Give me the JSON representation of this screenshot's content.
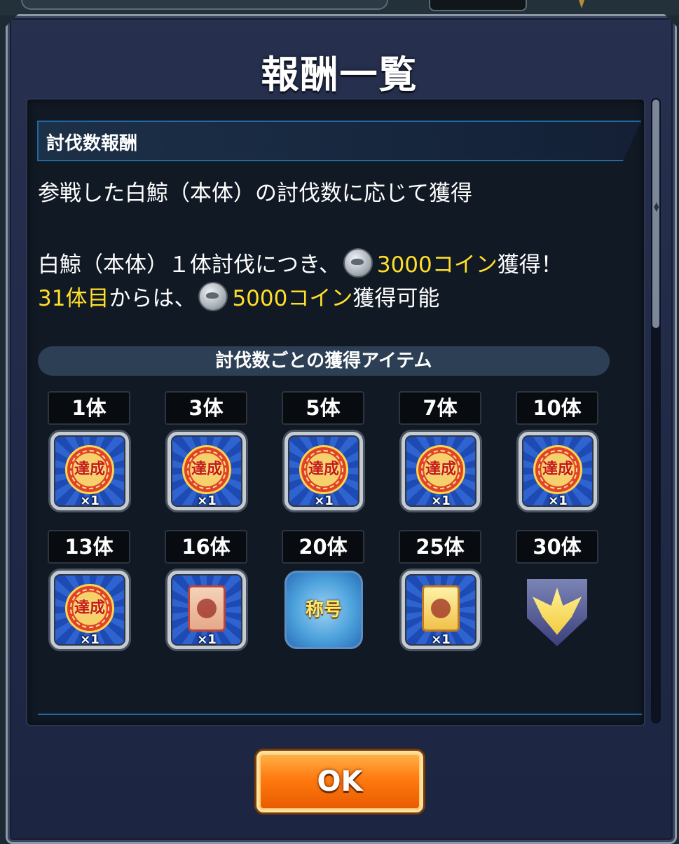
{
  "dialog": {
    "title": "報酬一覧",
    "section_header": "討伐数報酬",
    "description": "参戦した白鯨（本体）の討伐数に応じて獲得",
    "line1": {
      "pre": "白鯨（本体）１体討伐につき、",
      "amount": "3000コイン",
      "post": "獲得！"
    },
    "line2": {
      "highlight": "31体目",
      "pre": "からは、",
      "amount": "5000コイン",
      "post": "獲得可能"
    },
    "items_header": "討伐数ごとの獲得アイテム",
    "ok_label": "OK"
  },
  "rewards": [
    {
      "count": "1体",
      "type": "badge",
      "badge_label": "達成",
      "qty": "×1"
    },
    {
      "count": "3体",
      "type": "badge",
      "badge_label": "達成",
      "qty": "×1"
    },
    {
      "count": "5体",
      "type": "badge",
      "badge_label": "達成",
      "qty": "×1"
    },
    {
      "count": "7体",
      "type": "badge",
      "badge_label": "達成",
      "qty": "×1"
    },
    {
      "count": "10体",
      "type": "badge",
      "badge_label": "達成",
      "qty": "×1"
    },
    {
      "count": "13体",
      "type": "badge",
      "badge_label": "達成",
      "qty": "×1"
    },
    {
      "count": "16体",
      "type": "scroll-red",
      "qty": "×1"
    },
    {
      "count": "20体",
      "type": "title",
      "title_label": "称号"
    },
    {
      "count": "25体",
      "type": "scroll-gold",
      "qty": "×1"
    },
    {
      "count": "30体",
      "type": "emblem"
    }
  ],
  "colors": {
    "highlight": "#ffdf2a",
    "ok_button": "#ff7a10",
    "dialog_bg": "#222c4a"
  }
}
